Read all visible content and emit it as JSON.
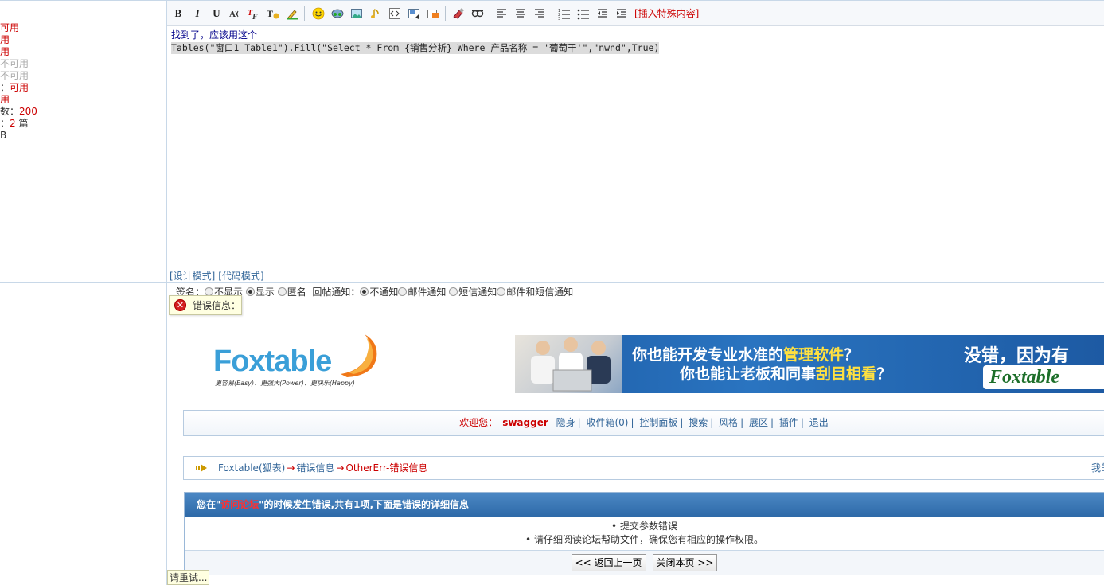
{
  "sidebar": {
    "perms": [
      {
        "text": "可用",
        "color": "red"
      },
      {
        "text": "用",
        "color": "red"
      },
      {
        "text": "用",
        "color": "red"
      },
      {
        "text": "不可用",
        "color": "gray"
      },
      {
        "text": "不可用",
        "color": "gray"
      },
      {
        "prefix": "：",
        "text": "可用",
        "color": "red"
      },
      {
        "text": "用",
        "color": "red"
      },
      {
        "prefix": "数：",
        "text": "200",
        "color": "red"
      },
      {
        "prefix": "：",
        "text": "2",
        "suffix": " 篇",
        "color": "red"
      },
      {
        "text": "B",
        "color": "dark"
      }
    ]
  },
  "toolbar": {
    "bold": "B",
    "italic": "I",
    "underline": "U",
    "insert_special": "[插入特殊内容]"
  },
  "editor": {
    "line1": "找到了，应该用这个",
    "line2": "Tables(\"窗口1_Table1\").Fill(\"Select * From {销售分析} Where 产品名称 = '葡萄干'\",\"nwnd\",True)"
  },
  "modes": {
    "design": "[设计模式]",
    "code": "[代码模式]"
  },
  "options": {
    "signature_label": "签名：",
    "sig_hide": "不显示",
    "sig_show": "显示",
    "sig_anon": "匿名",
    "notify_label": "回帖通知：",
    "notify_none": "不通知",
    "notify_mail": "邮件通知",
    "notify_sms": "短信通知",
    "notify_both": "邮件和短信通知"
  },
  "error_tip": "错误信息：",
  "logo": {
    "text": "Foxtable",
    "slogan": "更容易(Easy)、更强大(Power)、更快乐(Happy)"
  },
  "banner": {
    "q1_a": "你也能开发专业水准的",
    "q1_hl": "管理软件",
    "q1_b": "？",
    "q2_a": "你也能让老板和同事",
    "q2_hl": "刮目相看",
    "q2_b": "？",
    "right": "没错，因为有",
    "badge": "Foxtable"
  },
  "nav": {
    "welcome": "欢迎您：",
    "user": "swagger",
    "links": [
      "隐身",
      "收件箱(0)",
      "控制面板",
      "搜索",
      "风格",
      "展区",
      "插件",
      "退出"
    ]
  },
  "breadcrumb": {
    "home": "Foxtable(狐表)",
    "arrow": "→",
    "mid": "错误信息",
    "current": "OtherErr-错误信息",
    "right": "我的"
  },
  "error_panel": {
    "head_a": "您在\"",
    "head_em": "访问论坛",
    "head_b": "\"的时候发生错误,共有1项,下面是错误的详细信息",
    "items": [
      "• 提交参数错误",
      "• 请仔细阅读论坛帮助文件，确保您有相应的操作权限。"
    ],
    "back_button": "<< 返回上一页",
    "close_button": "关闭本页 >>"
  },
  "retry_tip": "请重试..."
}
